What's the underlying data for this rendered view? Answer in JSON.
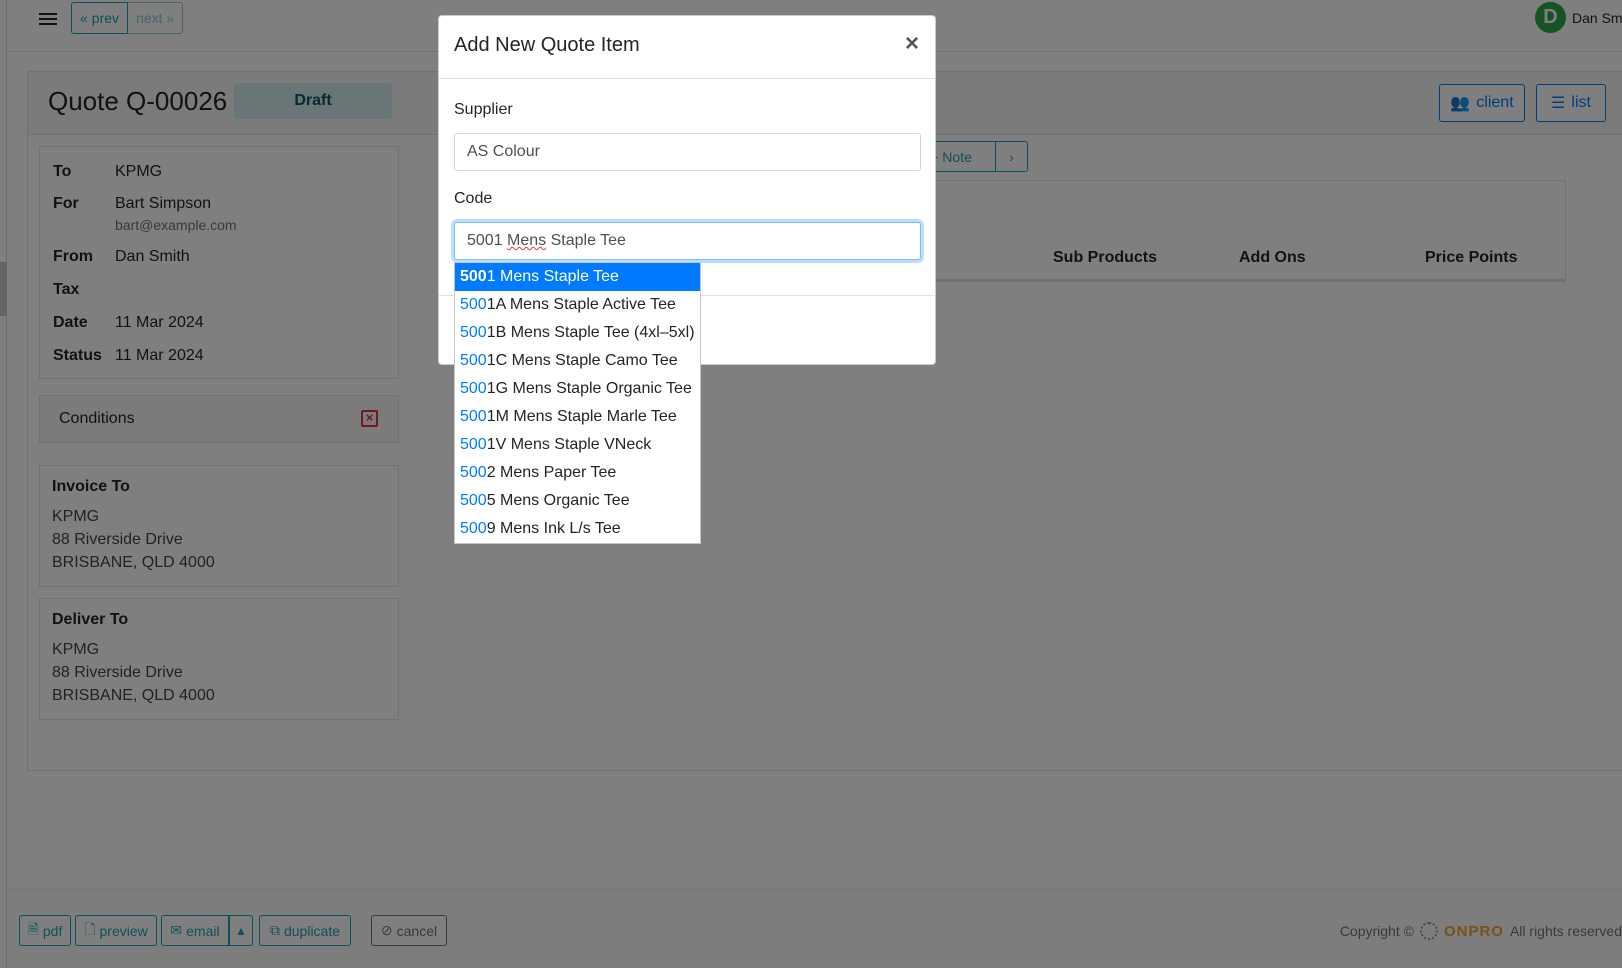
{
  "nav": {
    "prev_label": "prev",
    "next_label": "next",
    "user_initial": "D",
    "user_name": "Dan Smith"
  },
  "quote": {
    "title": "Quote Q-00026",
    "status_badge": "Draft",
    "client_button": "client",
    "list_button": "list",
    "details": {
      "to_label": "To",
      "to_value": "KPMG",
      "for_label": "For",
      "for_value": "Bart Simpson",
      "for_email": "bart@example.com",
      "from_label": "From",
      "from_value": "Dan Smith",
      "tax_label": "Tax",
      "tax_value": "",
      "date_label": "Date",
      "date_value": "11 Mar 2024",
      "status_label": "Status",
      "status_value": "11 Mar 2024"
    },
    "conditions_label": "Conditions",
    "invoice_to": {
      "title": "Invoice To",
      "lines": [
        "KPMG",
        "88 Riverside Drive",
        "BRISBANE, QLD 4000"
      ]
    },
    "deliver_to": {
      "title": "Deliver To",
      "lines": [
        "KPMG",
        "88 Riverside Drive",
        "BRISBANE, QLD 4000"
      ]
    },
    "toolbar": {
      "note_label": "Note"
    },
    "table_headers": [
      "Sub Products",
      "Add Ons",
      "Price Points"
    ]
  },
  "footer": {
    "pdf": "pdf",
    "preview": "preview",
    "email": "email",
    "duplicate": "duplicate",
    "cancel": "cancel",
    "copyright": "Copyright ©",
    "brand": "ONPRO",
    "rights": "All rights reserved"
  },
  "modal": {
    "title": "Add New Quote Item",
    "close": "×",
    "supplier_label": "Supplier",
    "supplier_value": "AS Colour",
    "code_label": "Code",
    "code_value_prefix": "5001 ",
    "code_value_squiggle": "Mens",
    "code_value_suffix": " Staple Tee",
    "suggestions": [
      {
        "match": "500",
        "rest": "1 Mens Staple Tee"
      },
      {
        "match": "500",
        "rest": "1A Mens Staple Active Tee"
      },
      {
        "match": "500",
        "rest": "1B Mens Staple Tee (4xl–5xl)"
      },
      {
        "match": "500",
        "rest": "1C Mens Staple Camo Tee"
      },
      {
        "match": "500",
        "rest": "1G Mens Staple Organic Tee"
      },
      {
        "match": "500",
        "rest": "1M Mens Staple Marle Tee"
      },
      {
        "match": "500",
        "rest": "1V Mens Staple VNeck"
      },
      {
        "match": "500",
        "rest": "2 Mens Paper Tee"
      },
      {
        "match": "500",
        "rest": "5 Mens Organic Tee"
      },
      {
        "match": "500",
        "rest": "9 Mens Ink L/s Tee"
      }
    ]
  },
  "colors": {
    "accent": "#007bff",
    "info": "#17a2b8",
    "success": "#28a745",
    "danger": "#dc3545"
  }
}
